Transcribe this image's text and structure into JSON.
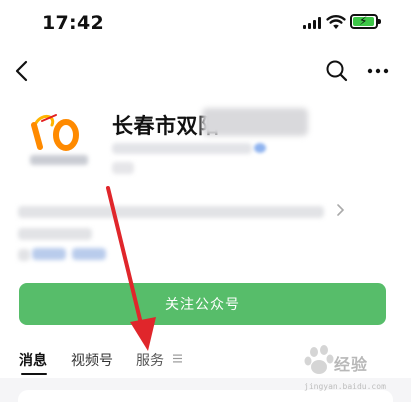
{
  "status_bar": {
    "time": "17:42",
    "icons": [
      "signal-icon",
      "wifi-icon",
      "battery-charging-icon"
    ],
    "battery_color": "#3ec748"
  },
  "nav": {
    "icons": [
      "back-arrow-icon",
      "search-icon",
      "more-icon"
    ]
  },
  "profile": {
    "avatar_logo_text": "10",
    "name": "长春市双阳"
  },
  "follow_button": {
    "label": "关注公众号",
    "color": "#57bd6a"
  },
  "tabs": [
    {
      "label": "消息",
      "active": true
    },
    {
      "label": "视频号",
      "active": false
    },
    {
      "label": "服务",
      "active": false
    }
  ],
  "overlay": {
    "arrow_color": "#e0262b",
    "watermark_text": "经验",
    "watermark_sub": "jingyan.baidu.com"
  }
}
